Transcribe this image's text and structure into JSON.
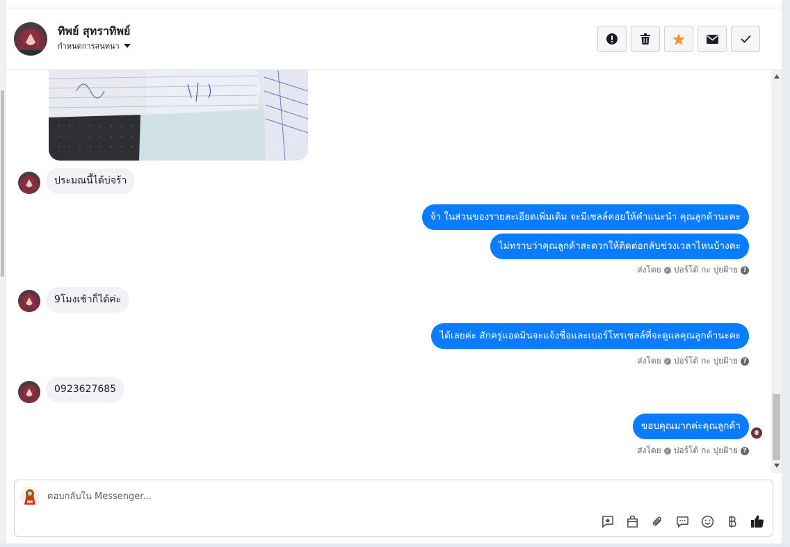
{
  "header": {
    "contact_name": "ทิพย์ สุทราทิพย์",
    "assign_label": "กำหนดการสนทนา",
    "buttons": [
      {
        "name": "report",
        "icon": "exclamation-icon"
      },
      {
        "name": "delete",
        "icon": "trash-icon"
      },
      {
        "name": "star",
        "icon": "star-icon",
        "color": "#f7923a"
      },
      {
        "name": "mark-unread",
        "icon": "envelope-icon"
      },
      {
        "name": "done",
        "icon": "checkmark-icon"
      }
    ]
  },
  "messages": {
    "in_1": "ประมณนี้ได้บ่จร้า",
    "out_1a": "จ้า  ในส่วนของรายละเอียดเพิ่มเติม จะมีเซลล์คอยให้คำแนะนำ คุณลูกค้านะคะ",
    "out_1b": "ไม่ทราบว่าคุณลูกค้าสะดวกให้ติดต่อกลับช่วงเวลาไหนบ้างคะ",
    "in_2": "9โมงเช้าก็ได้ค่ะ",
    "out_2": "ได้เลยค่ะ สักครู่แอดมินจะแจ้งชื่อและเบอร์โทรเซลล์ที่จะดูแลคุณลูกค้านะคะ",
    "in_3": "0923627685",
    "out_3": "ขอบคุณมากค่ะคุณลูกค้า"
  },
  "sent_by": {
    "prefix": "ส่งโดย",
    "agent": "ปอร์โต้ กะ ปุยฝ้าย"
  },
  "composer": {
    "placeholder": "ตอบกลับใน Messenger..."
  },
  "composer_icons": [
    "saved-reply-icon",
    "shopping-bag-icon",
    "paperclip-icon",
    "chat-bubble-icon",
    "emoji-icon",
    "baht-icon",
    "thumbs-up-icon"
  ],
  "colors": {
    "outgoing_bubble": "#0a7cff",
    "incoming_bubble": "#f0f2f5",
    "star": "#f7923a"
  }
}
